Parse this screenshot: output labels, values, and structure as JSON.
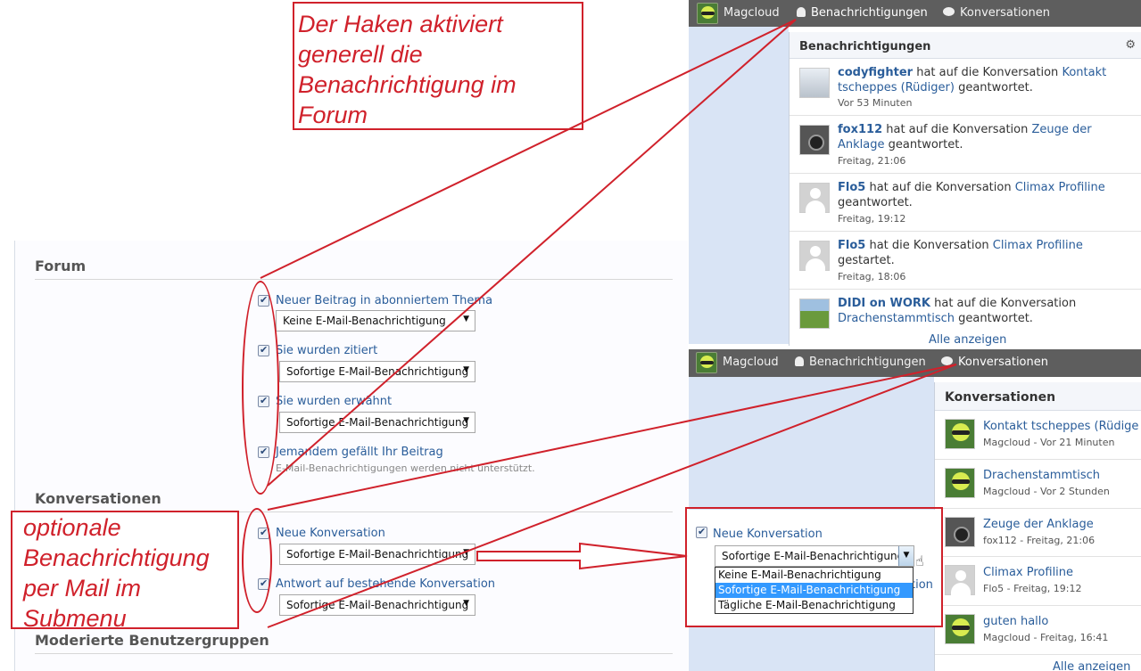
{
  "forum": {
    "title": "Forum",
    "options": [
      {
        "label": "Neuer Beitrag in abonniertem Thema",
        "select": "Keine E-Mail-Benachrichtigung"
      },
      {
        "label": "Sie wurden zitiert",
        "select": "Sofortige E-Mail-Benachrichtigung"
      },
      {
        "label": "Sie wurden erwähnt",
        "select": "Sofortige E-Mail-Benachrichtigung"
      },
      {
        "label": "Jemandem gefällt Ihr Beitrag",
        "hint": "E-Mail-Benachrichtigungen werden nicht unterstützt."
      }
    ]
  },
  "konversationen": {
    "title": "Konversationen",
    "options": [
      {
        "label": "Neue Konversation",
        "select": "Sofortige E-Mail-Benachrichtigung"
      },
      {
        "label": "Antwort auf bestehende Konversation",
        "select": "Sofortige E-Mail-Benachrichtigung"
      }
    ]
  },
  "moderated": {
    "title": "Moderierte Benutzergruppen"
  },
  "navbar": {
    "user": "Magcloud",
    "notifications": "Benachrichtigungen",
    "conversations": "Konversationen"
  },
  "notif_panel": {
    "title": "Benachrichtigungen",
    "see_all": "Alle anzeigen",
    "items": [
      {
        "user": "codyfighter",
        "action": "hat auf die Konversation",
        "link": "Kontakt tscheppes (Rüdiger)",
        "tail": "geantwortet.",
        "time": "Vor 53 Minuten",
        "thumb": "drone"
      },
      {
        "user": "fox112",
        "action": "hat auf die Konversation",
        "link": "Zeuge der Anklage",
        "tail": "geantwortet.",
        "time": "Freitag, 21:06",
        "thumb": "camera"
      },
      {
        "user": "Flo5",
        "action": "hat auf die Konversation",
        "link": "Climax Profiline",
        "tail": "geantwortet.",
        "time": "Freitag, 19:12",
        "thumb": "default-avatar"
      },
      {
        "user": "Flo5",
        "action": "hat die Konversation",
        "link": "Climax Profiline",
        "tail": "gestartet.",
        "time": "Freitag, 18:06",
        "thumb": "default-avatar"
      },
      {
        "user": "DIDI on WORK",
        "action": "hat auf die Konversation",
        "link": "Drachenstammtisch",
        "tail": "geantwortet.",
        "time": "",
        "thumb": "landscape"
      }
    ]
  },
  "conv_panel": {
    "title": "Konversationen",
    "see_all": "Alle anzeigen",
    "items": [
      {
        "title": "Kontakt tscheppes (Rüdige",
        "user": "Magcloud",
        "time": "Vor 21 Minuten",
        "thumb": "alien"
      },
      {
        "title": "Drachenstammtisch",
        "user": "Magcloud",
        "time": "Vor 2 Stunden",
        "thumb": "alien"
      },
      {
        "title": "Zeuge der Anklage",
        "user": "fox112",
        "time": "Freitag, 21:06",
        "thumb": "camera"
      },
      {
        "title": "Climax Profiline",
        "user": "Flo5",
        "time": "Freitag, 19:12",
        "thumb": "default-avatar"
      },
      {
        "title": "guten hallo",
        "user": "Magcloud",
        "time": "Freitag, 16:41",
        "thumb": "alien"
      }
    ]
  },
  "dropdown_demo": {
    "label": "Neue Konversation",
    "selected": "Sofortige E-Mail-Benachrichtigung",
    "options": [
      "Keine E-Mail-Benachrichtigung",
      "Sofortige E-Mail-Benachrichtigung",
      "Tägliche E-Mail-Benachrichtigung"
    ],
    "behind_text": "tion"
  },
  "annotations": {
    "top": "Der Haken aktiviert generell die Benachrichtigung im Forum",
    "bottom": "optionale Benachrichtigung per Mail im Submenu"
  },
  "colors": {
    "annotation": "#d0212b",
    "link": "#2a5d9a",
    "navbar": "#5e5e5e",
    "highlight": "#3399ff"
  }
}
